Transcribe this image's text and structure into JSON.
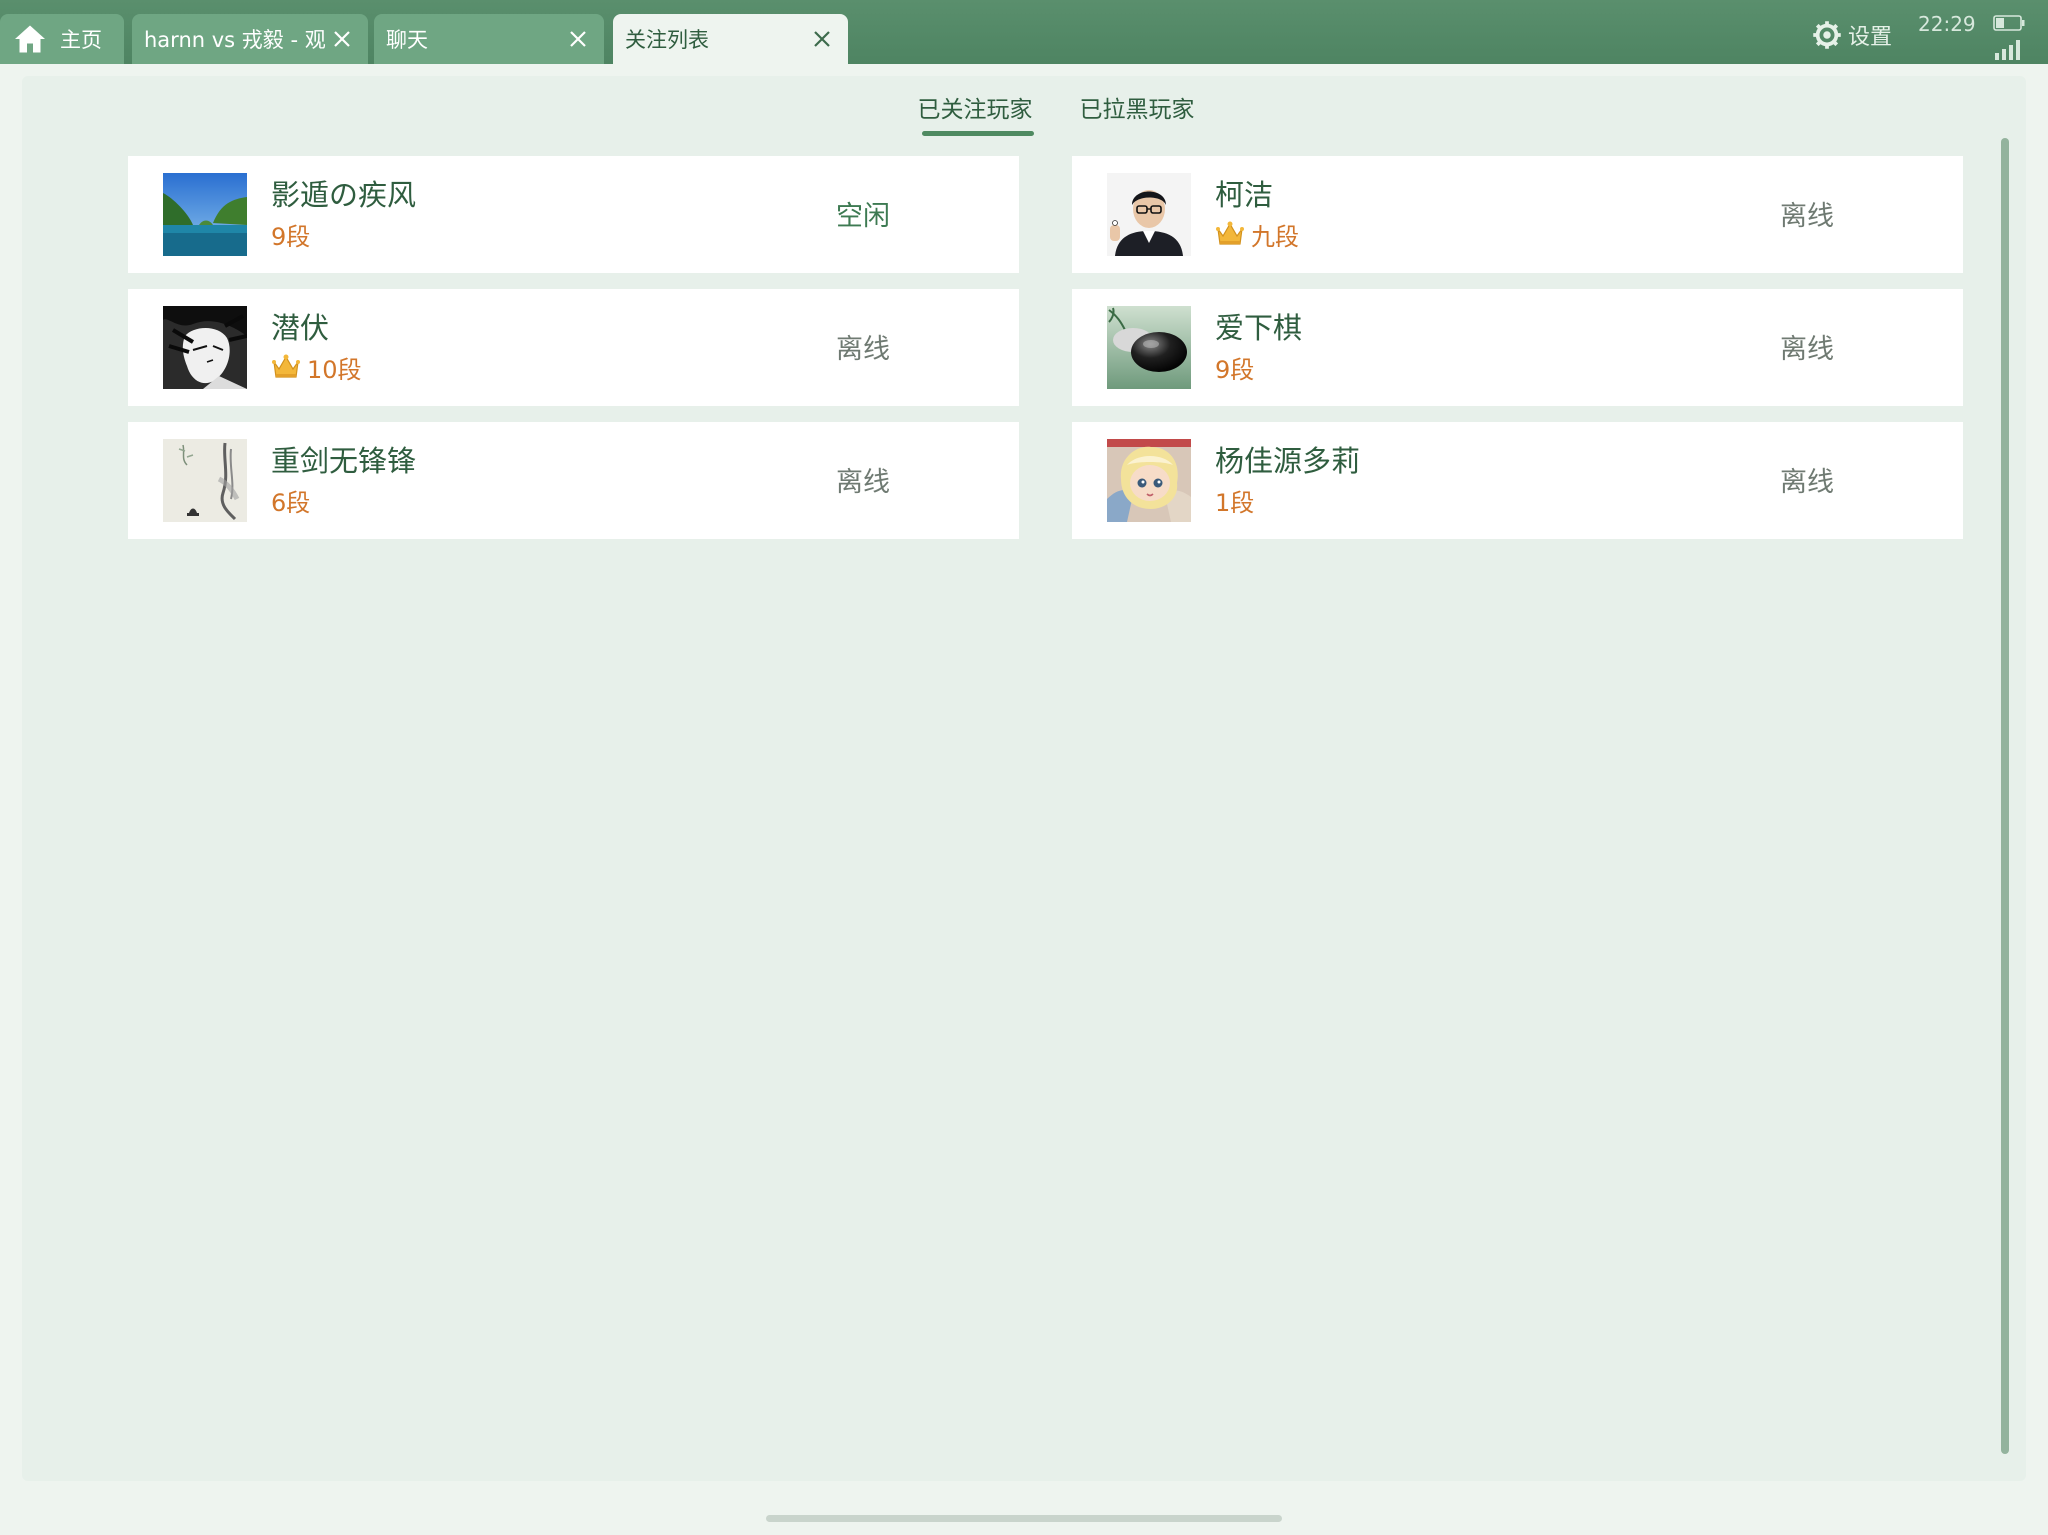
{
  "tabs": [
    {
      "label": "主页",
      "closable": false,
      "active": false
    },
    {
      "label": "harnn vs 戎毅 - 观",
      "closable": true,
      "active": false
    },
    {
      "label": "聊天",
      "closable": true,
      "active": false
    },
    {
      "label": "关注列表",
      "closable": true,
      "active": true
    }
  ],
  "settings_label": "设置",
  "status": {
    "time": "22:29"
  },
  "subtabs": {
    "followed": "已关注玩家",
    "blocked": "已拉黑玩家",
    "active": "followed"
  },
  "players": [
    {
      "name": "影遁の疾风",
      "rank": "9段",
      "crown": false,
      "status": "空闲",
      "avatar": "landscape-lagoon"
    },
    {
      "name": "柯洁",
      "rank": "九段",
      "crown": true,
      "status": "离线",
      "avatar": "man-glasses-portrait"
    },
    {
      "name": "潜伏",
      "rank": "10段",
      "crown": true,
      "status": "离线",
      "avatar": "anime-sketch-portrait"
    },
    {
      "name": "爱下棋",
      "rank": "9段",
      "crown": false,
      "status": "离线",
      "avatar": "go-stones"
    },
    {
      "name": "重剑无锋锋",
      "rank": "6段",
      "crown": false,
      "status": "离线",
      "avatar": "ink-painting"
    },
    {
      "name": "杨佳源多莉",
      "rank": "1段",
      "crown": false,
      "status": "离线",
      "avatar": "doll-portrait"
    }
  ],
  "colors": {
    "topbar": "#4e8462",
    "tab_inactive": "#6fa683",
    "accent_green": "#2f5d3f",
    "rank_orange": "#d2762a",
    "panel_bg": "#e7f0ea"
  }
}
